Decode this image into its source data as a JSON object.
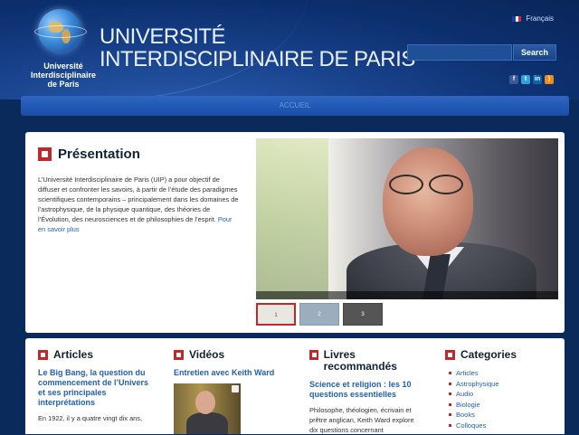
{
  "header": {
    "logo_text": [
      "Université",
      "Interdisciplinaire",
      "de Paris"
    ],
    "title_line1": "UNIVERSITÉ",
    "title_line2": "INTERDISCIPLINAIRE DE PARIS",
    "language": "Français",
    "search": {
      "value": "",
      "placeholder": "",
      "button_label": "Search"
    },
    "social": [
      "facebook-icon",
      "twitter-icon",
      "linkedin-icon",
      "rss-icon"
    ]
  },
  "nav": {
    "items": [
      "ACCUEIL"
    ]
  },
  "presentation": {
    "title": "Présentation",
    "text": "L’Université Interdisciplinaire de Paris (UIP) a pour objectif de diffuser et confronter les savoirs, à partir de l’étude des paradigmes scientifiques contemporains – principalement dans les domaines de l’astrophysique, de la physique quantique, des théories de l’Évolution, des neurosciences et de philosophies de l’esprit.",
    "more_link": "Pour en savoir plus",
    "thumbs": [
      "1",
      "2",
      "3"
    ]
  },
  "columns": {
    "articles": {
      "title": "Articles",
      "headline": "Le Big Bang, la question du commencement de l’Univers et ses principales interprétations",
      "excerpt": "En 1922, il y a quatre vingt dix ans,"
    },
    "videos": {
      "title": "Vidéos",
      "headline": "Entretien avec Keith Ward"
    },
    "livres": {
      "title": "Livres recommandés",
      "headline": "Science et religion : les 10 questions essentielles",
      "excerpt": "Philosophe, théologien, écrivain et prêtre anglican, Keith Ward explore dix questions concernant"
    },
    "categories": {
      "title": "Categories",
      "items": [
        "Articles",
        "Astrophysique",
        "Audio",
        "Biologie",
        "Books",
        "Colloques"
      ]
    }
  },
  "colors": {
    "accent": "#c0282b",
    "link": "#1f5fb8",
    "header": "#0c2f6e"
  }
}
